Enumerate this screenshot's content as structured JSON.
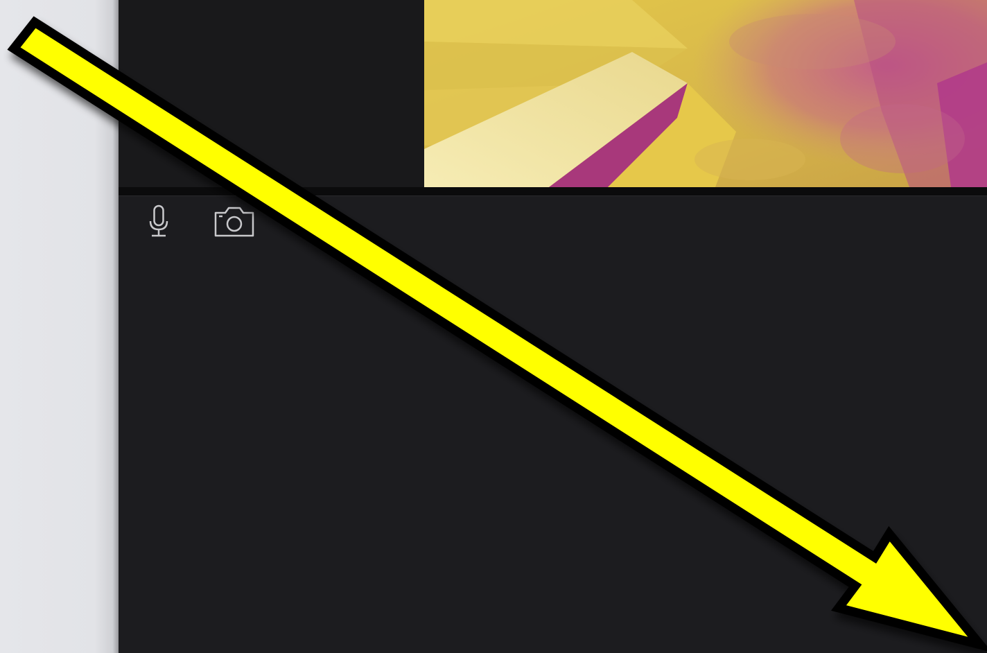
{
  "colors": {
    "gutter": "#e3e4e8",
    "panel_dark": "#19191b",
    "workspace": "#1c1c1f",
    "divider": "#0b0b0c",
    "icon_stroke": "#c9c9cc",
    "arrow_fill": "#ffff00",
    "arrow_outline": "#000000",
    "preview_yellow": "#e2c73e",
    "preview_magenta": "#b0407f"
  },
  "toolbar": {
    "mic_icon": "microphone-icon",
    "camera_icon": "camera-icon"
  },
  "annotation": {
    "type": "arrow",
    "direction": "down-right"
  }
}
